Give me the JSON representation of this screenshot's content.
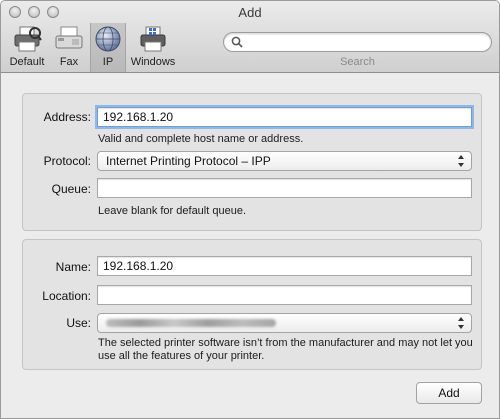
{
  "window": {
    "title": "Add"
  },
  "toolbar": {
    "items": [
      {
        "label": "Default",
        "icon": "printer-default-icon"
      },
      {
        "label": "Fax",
        "icon": "fax-icon"
      },
      {
        "label": "IP",
        "icon": "globe-icon",
        "selected": true
      },
      {
        "label": "Windows",
        "icon": "windows-printer-icon"
      }
    ],
    "search": {
      "label": "Search",
      "value": "",
      "placeholder": ""
    }
  },
  "group1": {
    "address": {
      "label": "Address:",
      "value": "192.168.1.20",
      "hint": "Valid and complete host name or address."
    },
    "protocol": {
      "label": "Protocol:",
      "value": "Internet Printing Protocol – IPP"
    },
    "queue": {
      "label": "Queue:",
      "value": "",
      "hint": "Leave blank for default queue."
    }
  },
  "group2": {
    "name": {
      "label": "Name:",
      "value": "192.168.1.20"
    },
    "location": {
      "label": "Location:",
      "value": ""
    },
    "use": {
      "label": "Use:",
      "hint": "The selected printer software isn’t from the manufacturer and may not let you use all the features of your printer."
    }
  },
  "actions": {
    "add_label": "Add"
  },
  "colors": {
    "focus_ring": "#8fb7ea",
    "window_bg": "#ececec",
    "group_bg": "#e3e3e3"
  }
}
